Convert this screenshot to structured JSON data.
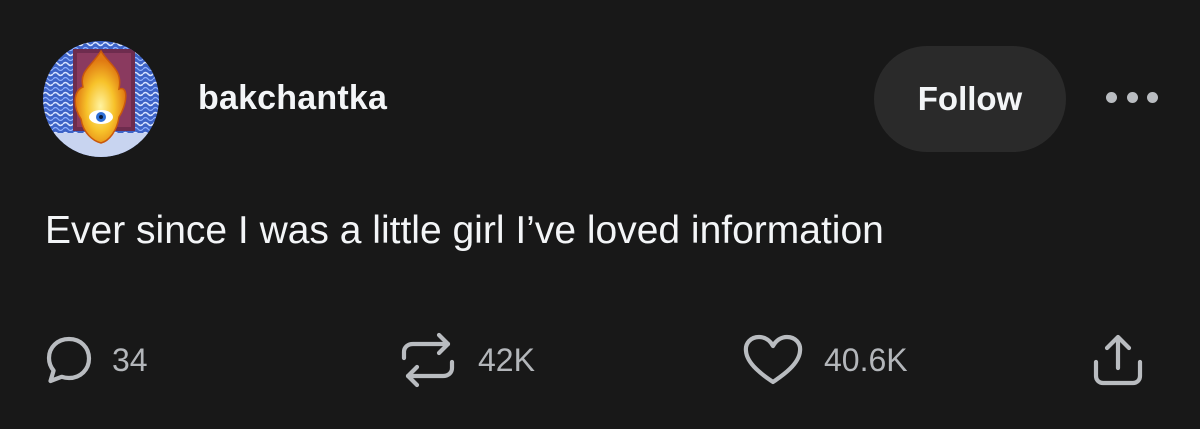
{
  "post": {
    "username": "bakchantka",
    "follow_label": "Follow",
    "text": "Ever since I was a little girl I’ve loved information"
  },
  "actions": {
    "reply": {
      "icon": "reply-bubble-icon",
      "count": "34"
    },
    "repost": {
      "icon": "repost-arrows-icon",
      "count": "42K"
    },
    "like": {
      "icon": "heart-icon",
      "count": "40.6K"
    },
    "share": {
      "icon": "share-upload-icon"
    }
  },
  "colors": {
    "background": "#181818",
    "text_primary": "#f3f5f7",
    "text_secondary": "#b3b6ba",
    "button_bg": "#2a2a2a",
    "icon": "#b9bcc0"
  }
}
